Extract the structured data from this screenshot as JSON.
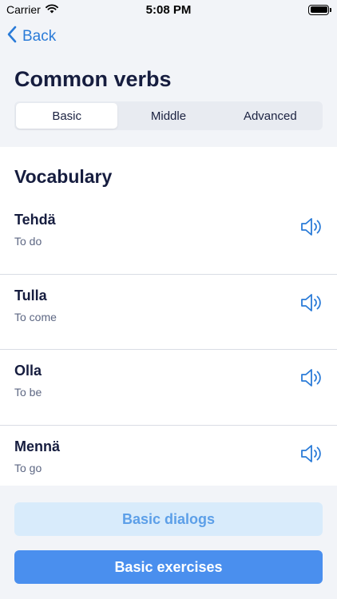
{
  "status": {
    "carrier": "Carrier",
    "time": "5:08 PM",
    "battery_level": 1.0
  },
  "nav": {
    "back_label": "Back"
  },
  "page": {
    "title": "Common verbs"
  },
  "tabs": [
    {
      "label": "Basic",
      "active": true
    },
    {
      "label": "Middle",
      "active": false
    },
    {
      "label": "Advanced",
      "active": false
    }
  ],
  "vocabulary": {
    "title": "Vocabulary",
    "items": [
      {
        "word": "Tehdä",
        "translation": "To do"
      },
      {
        "word": "Tulla",
        "translation": "To come"
      },
      {
        "word": "Olla",
        "translation": "To be"
      },
      {
        "word": "Mennä",
        "translation": "To go"
      }
    ]
  },
  "actions": {
    "dialogs_label": "Basic dialogs",
    "exercises_label": "Basic exercises"
  },
  "colors": {
    "accent": "#2a7bd8",
    "primary_button": "#4a8fee",
    "secondary_button": "#d8ebfb",
    "title_text": "#161d3f"
  },
  "icons": {
    "back": "chevron-left-icon",
    "speaker": "speaker-icon",
    "wifi": "wifi-icon",
    "battery": "battery-icon"
  }
}
